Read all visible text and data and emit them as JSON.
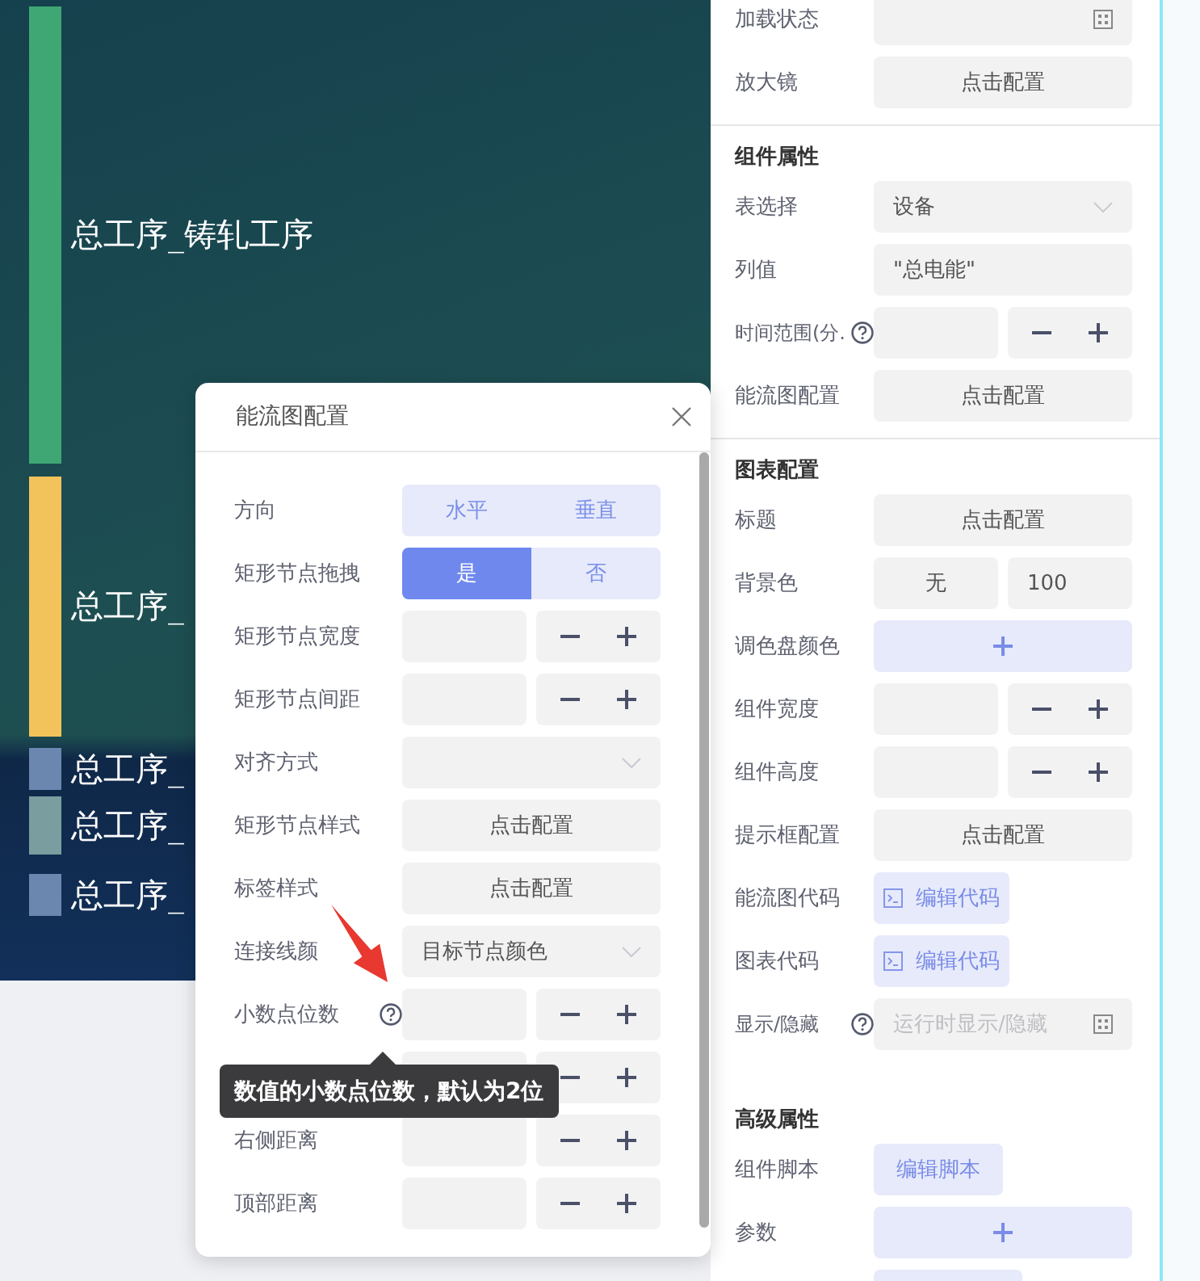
{
  "canvas": {
    "nodes": [
      {
        "kind": "bar",
        "label": "总工序_铸轧工序",
        "color": "#3fa774"
      },
      {
        "kind": "bar",
        "label": "总工序_",
        "color": "#f2c35a"
      },
      {
        "kind": "square",
        "label": "总工序_",
        "color": "#6b87b0"
      },
      {
        "kind": "square",
        "label": "总工序_",
        "color": "#7a9ea0"
      },
      {
        "kind": "square",
        "label": "总工序_",
        "color": "#6b87b0"
      }
    ]
  },
  "dialog": {
    "title": "能流图配置",
    "rows": [
      {
        "label": "方向",
        "kind": "segmented",
        "help": false,
        "options": [
          {
            "label": "水平",
            "selected": false
          },
          {
            "label": "垂直",
            "selected": false
          }
        ]
      },
      {
        "label": "矩形节点拖拽",
        "kind": "segmented",
        "help": false,
        "options": [
          {
            "label": "是",
            "selected": true
          },
          {
            "label": "否",
            "selected": false
          }
        ]
      },
      {
        "label": "矩形节点宽度",
        "kind": "stepper",
        "help": false
      },
      {
        "label": "矩形节点间距",
        "kind": "stepper",
        "help": false
      },
      {
        "label": "对齐方式",
        "kind": "select",
        "help": false
      },
      {
        "label": "矩形节点样式",
        "kind": "button",
        "help": false,
        "value": "点击配置"
      },
      {
        "label": "标签样式",
        "kind": "button",
        "help": false,
        "value": "点击配置"
      },
      {
        "label": "连接线颜",
        "kind": "select",
        "help": false,
        "value": "目标节点颜色"
      },
      {
        "label": "小数点位数",
        "kind": "stepper",
        "help": true
      },
      {
        "kind": "stepper",
        "help": false
      },
      {
        "label": "右侧距离",
        "kind": "stepper",
        "help": false
      },
      {
        "label": "顶部距离",
        "kind": "stepper",
        "help": false
      }
    ]
  },
  "tooltip": {
    "text": "数值的小数点位数，默认为2位"
  },
  "properties": {
    "sections": [
      {
        "divider": false,
        "rows": [
          {
            "label": "加载状态",
            "kind": "icon-field",
            "help": false
          },
          {
            "label": "放大镜",
            "kind": "button",
            "help": false,
            "value": "点击配置"
          }
        ]
      },
      {
        "divider": true,
        "heading": "组件属性",
        "rows": [
          {
            "label": "表选择",
            "kind": "select",
            "help": false,
            "value": "设备"
          },
          {
            "label": "列值",
            "kind": "text",
            "help": false,
            "value": "\"总电能\""
          },
          {
            "label": "时间范围(分.",
            "kind": "stepper",
            "help": true
          },
          {
            "label": "能流图配置",
            "kind": "button",
            "help": false,
            "value": "点击配置"
          }
        ]
      },
      {
        "divider": true,
        "heading": "图表配置",
        "rows": [
          {
            "label": "标题",
            "kind": "button",
            "help": false,
            "value": "点击配置"
          },
          {
            "label": "背景色",
            "kind": "pair",
            "help": false,
            "values": [
              "无",
              "100"
            ]
          },
          {
            "label": "调色盘颜色",
            "kind": "add",
            "help": false
          },
          {
            "label": "组件宽度",
            "kind": "stepper",
            "help": false
          },
          {
            "label": "组件高度",
            "kind": "stepper",
            "help": false
          },
          {
            "label": "提示框配置",
            "kind": "button",
            "help": false,
            "value": "点击配置"
          },
          {
            "label": "能流图代码",
            "kind": "code",
            "help": false,
            "value": "编辑代码"
          },
          {
            "label": "图表代码",
            "kind": "code",
            "help": false,
            "value": "编辑代码"
          },
          {
            "label": "显示/隐藏",
            "kind": "icon-field",
            "help": true,
            "placeholder": "运行时显示/隐藏"
          }
        ]
      },
      {
        "divider": false,
        "heading": "高级属性",
        "rows": [
          {
            "label": "组件脚本",
            "kind": "script",
            "help": false,
            "value": "编辑脚本"
          },
          {
            "label": "参数",
            "kind": "add",
            "help": false
          },
          {
            "kind": "blank",
            "help": false
          }
        ]
      }
    ]
  }
}
